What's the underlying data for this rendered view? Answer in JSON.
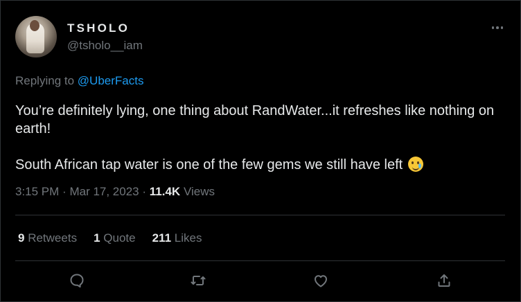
{
  "author": {
    "display_name": "TSHOLO",
    "handle": "@tsholo__iam"
  },
  "reply": {
    "prefix": "Replying to",
    "mention": "@UberFacts"
  },
  "tweet": {
    "line1": "You’re definitely lying, one thing about RandWater...it refreshes like nothing on earth!",
    "line2": "South African tap water is one of the few gems we still have left",
    "emoji": "smiling-face-with-tear"
  },
  "meta": {
    "time": "3:15 PM",
    "sep1": "·",
    "date": "Mar 17, 2023",
    "sep2": "·",
    "views_count": "11.4K",
    "views_label": "Views"
  },
  "stats": {
    "retweets_count": "9",
    "retweets_label": "Retweets",
    "quotes_count": "1",
    "quotes_label": "Quote",
    "likes_count": "211",
    "likes_label": "Likes"
  },
  "actions": [
    "reply-icon",
    "retweet-icon",
    "like-icon",
    "share-icon"
  ],
  "colors": {
    "background": "#000000",
    "text": "#e7e9ea",
    "muted": "#71767b",
    "accent": "#1d9bf0",
    "divider": "#2f3336"
  }
}
